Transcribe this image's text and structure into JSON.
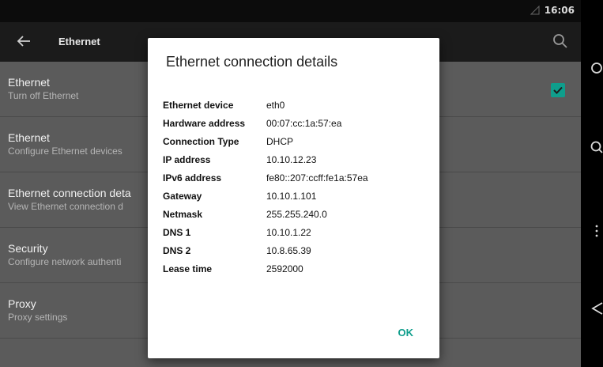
{
  "status_bar": {
    "time": "16:06",
    "signal_icon": "signal-triangle-icon"
  },
  "toolbar": {
    "title": "Ethernet",
    "back_icon": "arrow-back-icon",
    "search_icon": "search-icon"
  },
  "settings_list": [
    {
      "title": "Ethernet",
      "subtitle": "Turn off Ethernet",
      "checked": true
    },
    {
      "title": "Ethernet",
      "subtitle": "Configure Ethernet devices"
    },
    {
      "title": "Ethernet connection deta",
      "subtitle": "View Ethernet connection d"
    },
    {
      "title": "Security",
      "subtitle": "Configure network authenti"
    },
    {
      "title": "Proxy",
      "subtitle": "Proxy settings"
    }
  ],
  "dialog": {
    "title": "Ethernet connection details",
    "rows": [
      {
        "label": "Ethernet device",
        "value": "eth0"
      },
      {
        "label": "Hardware address",
        "value": "00:07:cc:1a:57:ea"
      },
      {
        "label": "Connection Type",
        "value": "DHCP"
      },
      {
        "label": "IP address",
        "value": "10.10.12.23"
      },
      {
        "label": "IPv6 address",
        "value": "fe80::207:ccff:fe1a:57ea"
      },
      {
        "label": "Gateway",
        "value": "10.10.1.101"
      },
      {
        "label": "Netmask",
        "value": "255.255.240.0"
      },
      {
        "label": "DNS 1",
        "value": "10.10.1.22"
      },
      {
        "label": "DNS 2",
        "value": "10.8.65.39"
      },
      {
        "label": "Lease time",
        "value": "2592000"
      }
    ],
    "ok_label": "OK"
  },
  "nav_bar": [
    "home-circle-icon",
    "search-circle-icon",
    "more-vert-icon",
    "back-triangle-icon"
  ],
  "colors": {
    "accent": "#0f9e8c",
    "toolbar": "#1b1b1b",
    "statusbar": "#0c0c0c",
    "list_bg_dimmed": "#5b5b5b"
  }
}
